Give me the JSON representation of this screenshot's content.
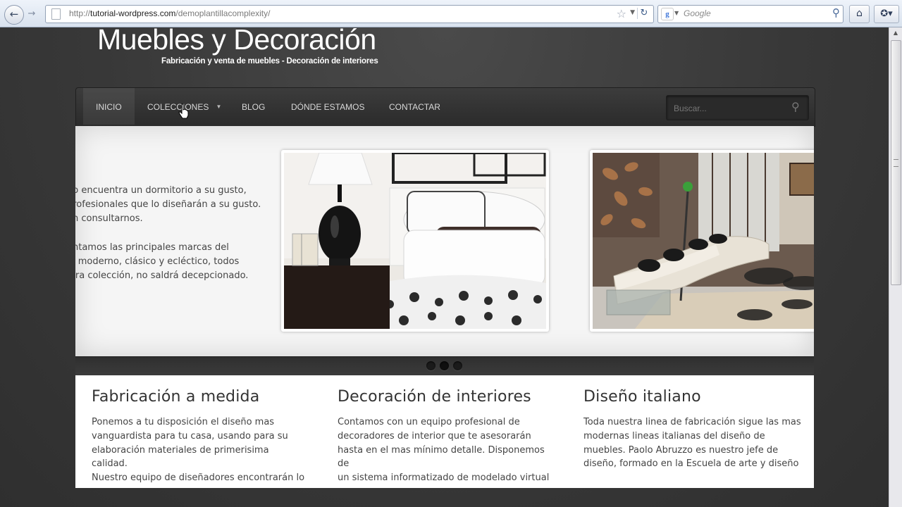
{
  "browser": {
    "url_prefix": "http://",
    "url_host": "tutorial-wordpress.com",
    "url_path": "/demoplantillacomplexity/",
    "search_placeholder": "Google"
  },
  "site": {
    "logo_title": "Muebles y Decoración",
    "logo_tagline": "Fabricación y venta de muebles - Decoración de interiores"
  },
  "nav": {
    "items": [
      {
        "label": "INICIO"
      },
      {
        "label": "COLECCIONES"
      },
      {
        "label": "BLOG"
      },
      {
        "label": "DÓNDE ESTAMOS"
      },
      {
        "label": "CONTACTAR"
      }
    ],
    "search_placeholder": "Buscar..."
  },
  "slider": {
    "paragraphs": [
      [
        "no encuentra un dormitorio a su gusto,",
        "profesionales que lo diseñarán a su gusto.",
        "en consultarnos."
      ],
      [
        "entamos las principales marcas del",
        "lo moderno, clásico y ecléctico, todos",
        "stra colección, no saldrá decepcionado."
      ]
    ],
    "dot_count": 3,
    "active_dot": 2
  },
  "features": [
    {
      "title": "Fabricación a medida",
      "lines": [
        "Ponemos a tu disposición el diseño mas",
        "vanguardista para tu casa, usando para su",
        "elaboración materiales de primerisima calidad.",
        "Nuestro equipo de diseñadores encontrarán lo"
      ]
    },
    {
      "title": "Decoración de interiores",
      "lines": [
        "Contamos con un equipo profesional de",
        "decoradores de interior que te asesorarán",
        "hasta en el mas mínimo detalle. Disponemos de",
        "un sistema informatizado de modelado virtual"
      ]
    },
    {
      "title": "Diseño italiano",
      "lines": [
        "Toda nuestra linea de fabricación sigue las mas",
        "modernas lineas italianas del diseño de",
        "muebles. Paolo Abruzzo es nuestro jefe de",
        "diseño, formado en la Escuela de arte y diseño"
      ]
    }
  ],
  "colors": {
    "page_bg": "#383838",
    "nav_bg": "#333333",
    "content_bg": "#ffffff"
  }
}
